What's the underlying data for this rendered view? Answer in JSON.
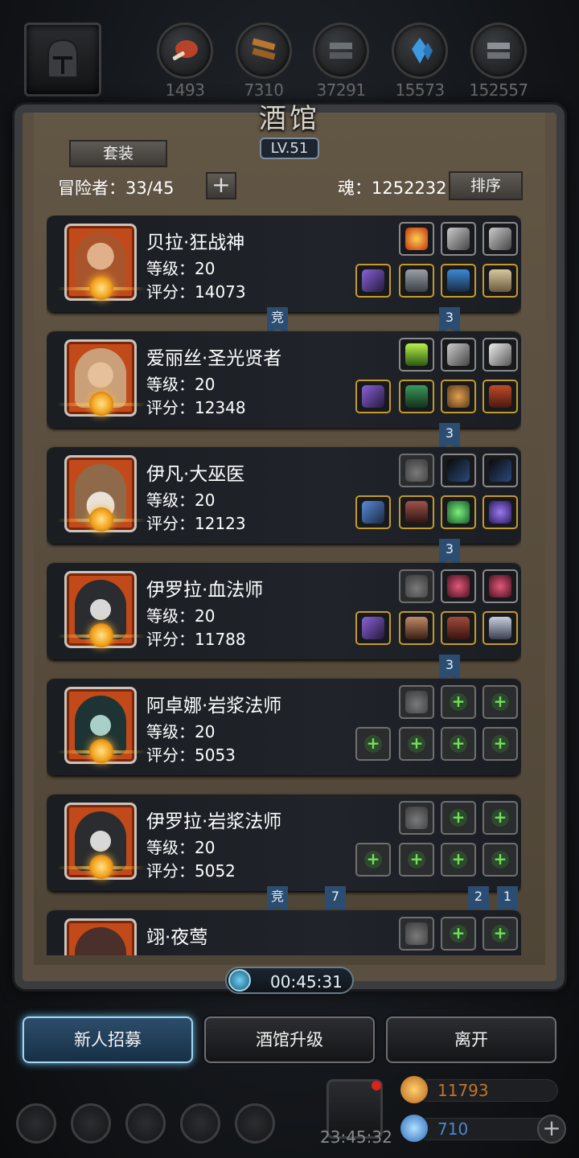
{
  "resources": [
    {
      "name": "meat-icon",
      "value": "1493",
      "color": "#c2452a"
    },
    {
      "name": "wood-icon",
      "value": "7310",
      "color": "#b9762e"
    },
    {
      "name": "iron-icon",
      "value": "37291",
      "color": "#6d7276"
    },
    {
      "name": "crystal-icon",
      "value": "15573",
      "color": "#3d9ae0"
    },
    {
      "name": "silver-icon",
      "value": "152557",
      "color": "#8d9196"
    }
  ],
  "title": "酒馆",
  "level": "LV.51",
  "suit_button": "套装",
  "adventurers": "冒险者：33/45",
  "soul": "魂：1252232",
  "sort_button": "排序",
  "heroes": [
    {
      "name": "贝拉·狂战神",
      "level": "等级：20",
      "score": "评分：14073",
      "face": "#a8552c"
    },
    {
      "name": "爱丽丝·圣光贤者",
      "level": "等级：20",
      "score": "评分：12348",
      "face": "#caa07a"
    },
    {
      "name": "伊凡·大巫医",
      "level": "等级：20",
      "score": "评分：12123",
      "face": "#8e6a4a"
    },
    {
      "name": "伊罗拉·血法师",
      "level": "等级：20",
      "score": "评分：11788",
      "face": "#6f7780"
    },
    {
      "name": "阿卓娜·岩浆法师",
      "level": "等级：20",
      "score": "评分：5053",
      "face": "#3e6a6a"
    },
    {
      "name": "伊罗拉·岩浆法师",
      "level": "等级：20",
      "score": "评分：5052",
      "face": "#6f7780"
    },
    {
      "name": "翊·夜莺",
      "level": "",
      "score": "",
      "face": "#4a2f2a"
    }
  ],
  "ribbons": {
    "row1": [
      "竞",
      "3"
    ],
    "row2": [
      "3"
    ],
    "row3": [
      "3"
    ],
    "row4": [
      "3"
    ],
    "row6": [
      "竞",
      "7",
      "2",
      "1"
    ]
  },
  "timer": "00:45:31",
  "buttons": {
    "recruit": "新人招募",
    "upgrade": "酒馆升级",
    "leave": "离开"
  },
  "gift_timer": "23:45:32",
  "currency": [
    {
      "name": "gold-chest-icon",
      "value": "11793",
      "color": "#d2872a"
    },
    {
      "name": "diamond-icon",
      "value": "710",
      "color": "#3f8fd8"
    }
  ]
}
